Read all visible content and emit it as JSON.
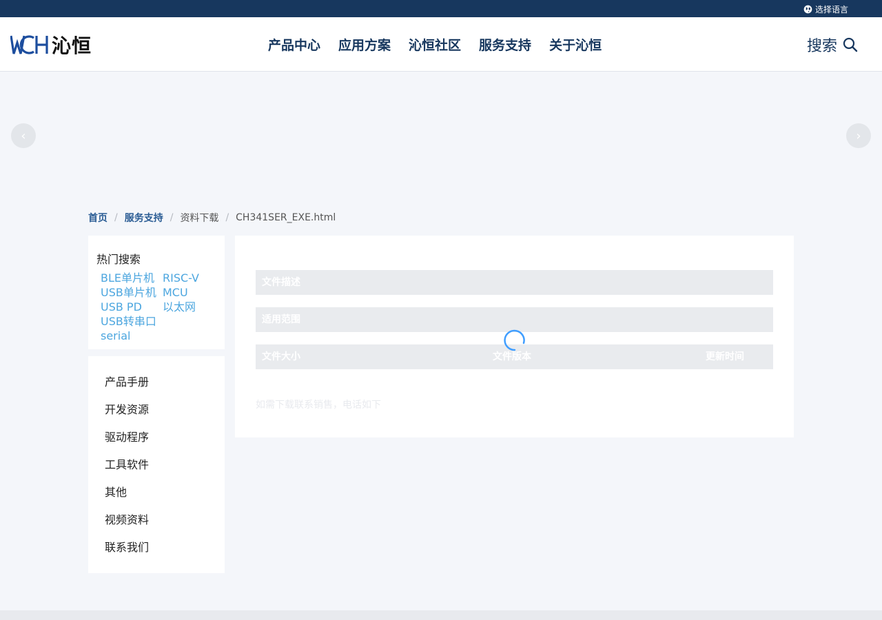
{
  "topbar": {
    "language_label": "选择语言"
  },
  "logo": {
    "mark": "WCH",
    "text": "沁恒"
  },
  "nav": {
    "items": [
      "产品中心",
      "应用方案",
      "沁恒社区",
      "服务支持",
      "关于沁恒"
    ]
  },
  "search": {
    "label": "搜索"
  },
  "banner": {
    "prev": "‹",
    "next": "›"
  },
  "breadcrumb": {
    "home": "首页",
    "service": "服务支持",
    "downloads": "资料下载",
    "current": "CH341SER_EXE.html"
  },
  "hot_search": {
    "title": "热门搜索",
    "items": [
      "BLE单片机",
      "RISC-V",
      "USB单片机",
      "MCU",
      "USB PD",
      "以太网",
      "USB转串口",
      "serial"
    ]
  },
  "side_menu": {
    "items": [
      "产品手册",
      "开发资源",
      "驱动程序",
      "工具软件",
      "其他",
      "视频资料",
      "联系我们"
    ]
  },
  "file_info": {
    "description_label": "文件描述",
    "scope_label": "适用范围",
    "size_label": "文件大小",
    "version_label": "文件版本",
    "updated_label": "更新时间",
    "contact_note": "如需下载联系销售，电话如下"
  },
  "colors": {
    "topbar": "#17375e",
    "nav_text": "#17375e",
    "link": "#4ca6df",
    "breadcrumb_link": "#2a5c94",
    "spinner": "#409eff"
  },
  "icons": {
    "language": "globe-icon",
    "search": "search-icon",
    "loading": "loading-spinner-icon"
  }
}
